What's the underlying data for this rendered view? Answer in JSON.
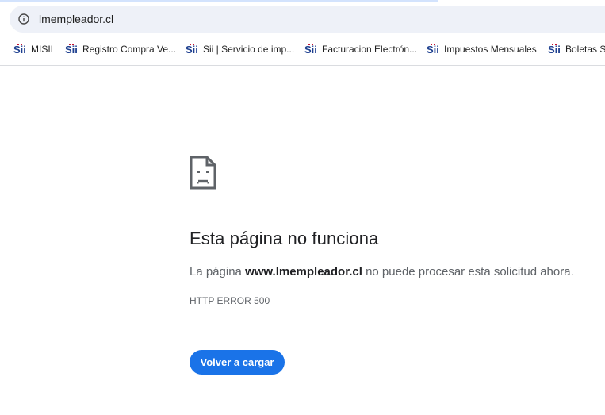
{
  "browser": {
    "url": "lmempleador.cl",
    "bookmarks": [
      {
        "label": "MISII",
        "icon": "sii-logo-icon"
      },
      {
        "label": "Registro Compra Ve...",
        "icon": "sii-logo-icon"
      },
      {
        "label": "Sii | Servicio de imp...",
        "icon": "sii-logo-icon"
      },
      {
        "label": "Facturacion Electrón...",
        "icon": "sii-logo-icon"
      },
      {
        "label": "Impuestos Mensuales",
        "icon": "sii-logo-icon"
      },
      {
        "label": "Boletas SII",
        "icon": "sii-logo-icon"
      }
    ]
  },
  "error": {
    "title": "Esta página no funciona",
    "message_prefix": "La página ",
    "domain": "www.lmempleador.cl",
    "message_suffix": " no puede procesar esta solicitud ahora.",
    "code": "HTTP ERROR 500",
    "reload_label": "Volver a cargar"
  },
  "colors": {
    "accent": "#1a73e8",
    "omnibox_bg": "#eef1f8",
    "sii_red": "#c8102e",
    "sii_blue": "#1d3f8f"
  }
}
